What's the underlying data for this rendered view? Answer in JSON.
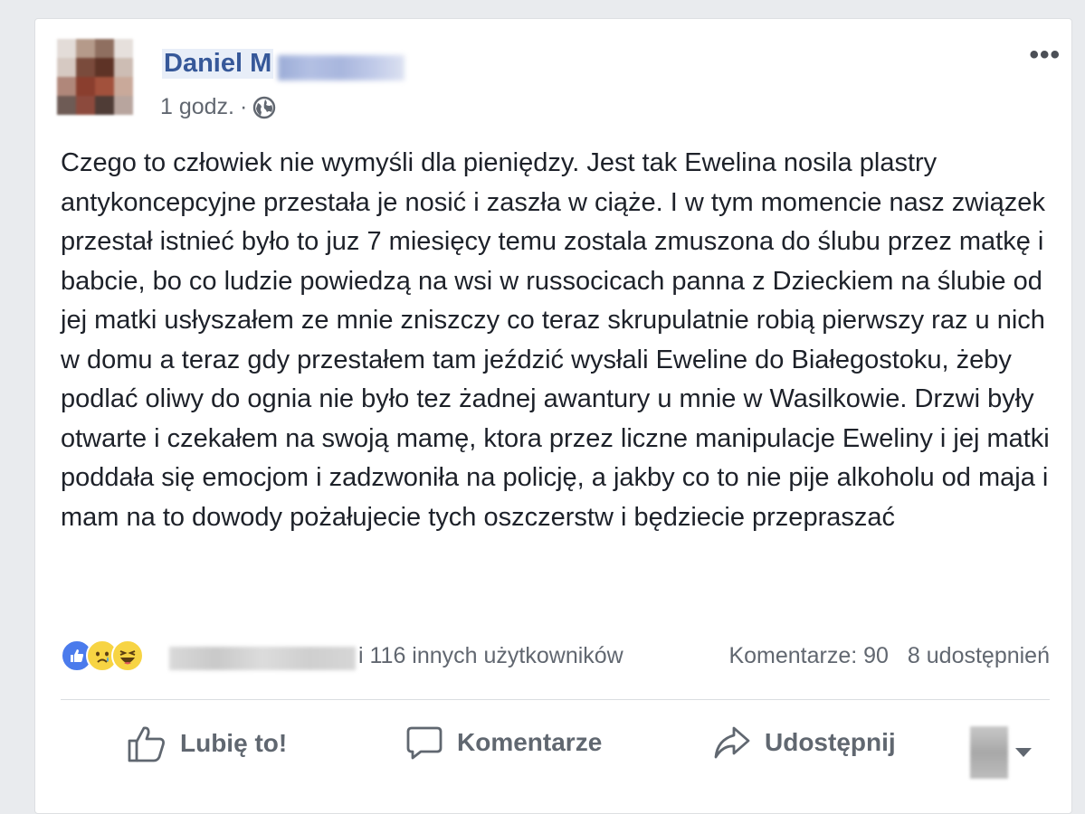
{
  "post": {
    "author_name": "Daniel M",
    "timestamp": "1 godz.",
    "separator": "·",
    "privacy_icon": "globe-icon",
    "more_icon": "•••",
    "text": "Czego to człowiek nie wymyśli dla pieniędzy. Jest tak Ewelina nosila plastry antykoncepcyjne przestała je nosić i zaszła w ciąże. I w tym momencie nasz związek przestał istnieć było to juz 7 miesięcy temu zostala zmuszona do ślubu przez matkę i babcie, bo co ludzie powiedzą na wsi w russocicach panna z Dzieckiem na ślubie od jej matki usłyszałem ze mnie zniszczy co teraz skrupulatnie robią pierwszy raz u nich w domu a teraz gdy przestałem tam jeździć wysłali Eweline do Białegostoku, żeby podlać oliwy do ognia nie było tez żadnej awantury u mnie w Wasilkowie. Drzwi były otwarte i czekałem na swoją mamę, ktora przez liczne manipulacje Eweliny i jej matki poddała się emocjom i zadzwoniła na policję, a jakby co to nie pije alkoholu od maja i mam na to dowody pożałujecie tych oszczerstw i będziecie przepraszać"
  },
  "reactions": {
    "icons": [
      "like-icon",
      "sad-icon",
      "haha-icon"
    ],
    "others_text": "i 116 innych użytkowników",
    "comments_text": "Komentarze: 90",
    "shares_text": "8 udostępnień"
  },
  "actions": {
    "like_label": "Lubię to!",
    "comment_label": "Komentarze",
    "share_label": "Udostępnij"
  },
  "colors": {
    "author_link": "#365899",
    "secondary_text": "#616770",
    "body_text": "#1d2129",
    "like_blue": "#4b7bec",
    "emoji_yellow": "#f7d443"
  }
}
